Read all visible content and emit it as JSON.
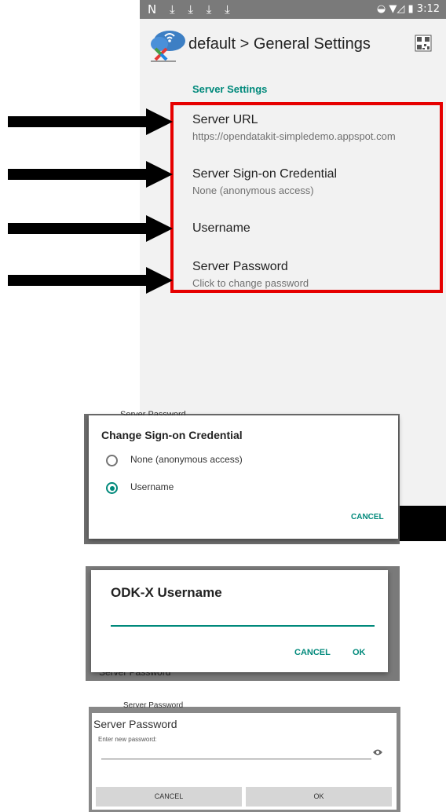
{
  "status_bar": {
    "left_icons": "N ⤓ ⤓ ⤓ ⤓",
    "time": "3:12"
  },
  "app_bar": {
    "title": "default > General Settings"
  },
  "server_settings": {
    "section_title": "Server Settings",
    "items": [
      {
        "title": "Server URL",
        "summary": "https://opendatakit-simpledemo.appspot.com"
      },
      {
        "title": "Server Sign-on Credential",
        "summary": "None (anonymous access)"
      },
      {
        "title": "Username",
        "summary": ""
      },
      {
        "title": "Server Password",
        "summary": "Click to change password"
      }
    ]
  },
  "credential_dialog": {
    "title": "Change Sign-on Credential",
    "options": [
      {
        "label": "None (anonymous access)",
        "selected": false
      },
      {
        "label": "Username",
        "selected": true
      }
    ],
    "cancel_label": "CANCEL",
    "peek_text": "Server Password"
  },
  "username_dialog": {
    "title": "ODK-X Username",
    "input_value": "",
    "cancel_label": "CANCEL",
    "ok_label": "OK",
    "peek_text": "Server Password"
  },
  "password_dialog": {
    "title": "Server Password",
    "prompt": "Enter new password:",
    "input_value": "",
    "cancel_label": "CANCEL",
    "ok_label": "OK",
    "peek_text": "Server Password"
  },
  "icons": {
    "app_logo": "odk-cloud-logo-icon",
    "qr": "qr-code-icon",
    "visibility": "eye-icon",
    "arrows": "arrow-right-icon"
  },
  "colors": {
    "accent": "#00897b",
    "highlight_border": "#e60000",
    "status_bar": "#7a7a7a"
  }
}
